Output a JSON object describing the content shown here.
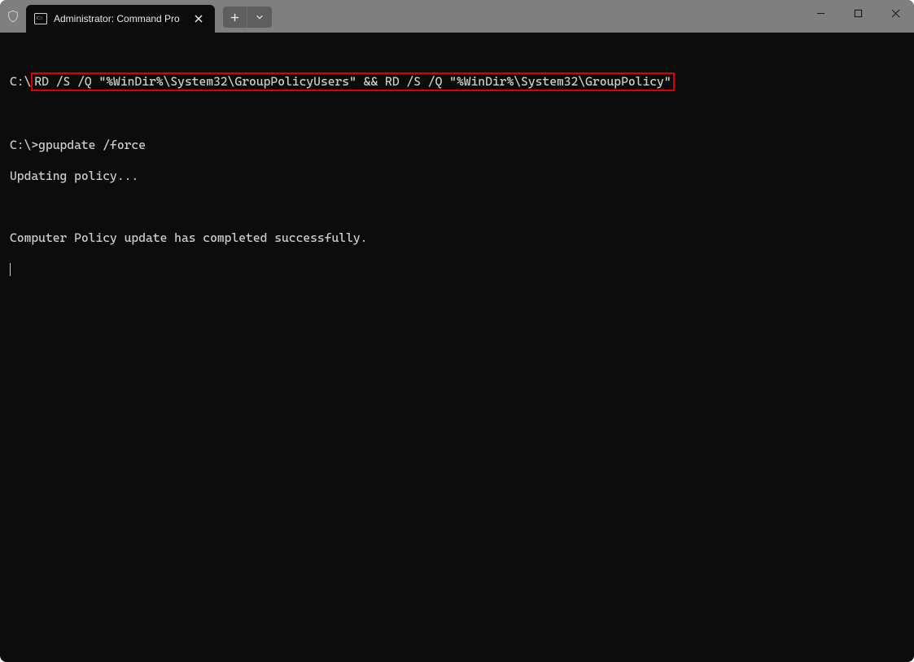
{
  "tab": {
    "title": "Administrator: Command Pro"
  },
  "terminal": {
    "prompt1_prefix": "C:\\",
    "command1_partA": "RD /S /Q \"%WinDir%\\System32\\GroupPolicyUsers\"",
    "command1_join": " && ",
    "command1_partB": "RD /S /Q \"%WinDir%\\System32\\GroupPolicy\"",
    "prompt2": "C:\\>",
    "command2": "gpupdate /force",
    "output1": "Updating policy...",
    "output2": "Computer Policy update has completed successfully."
  }
}
